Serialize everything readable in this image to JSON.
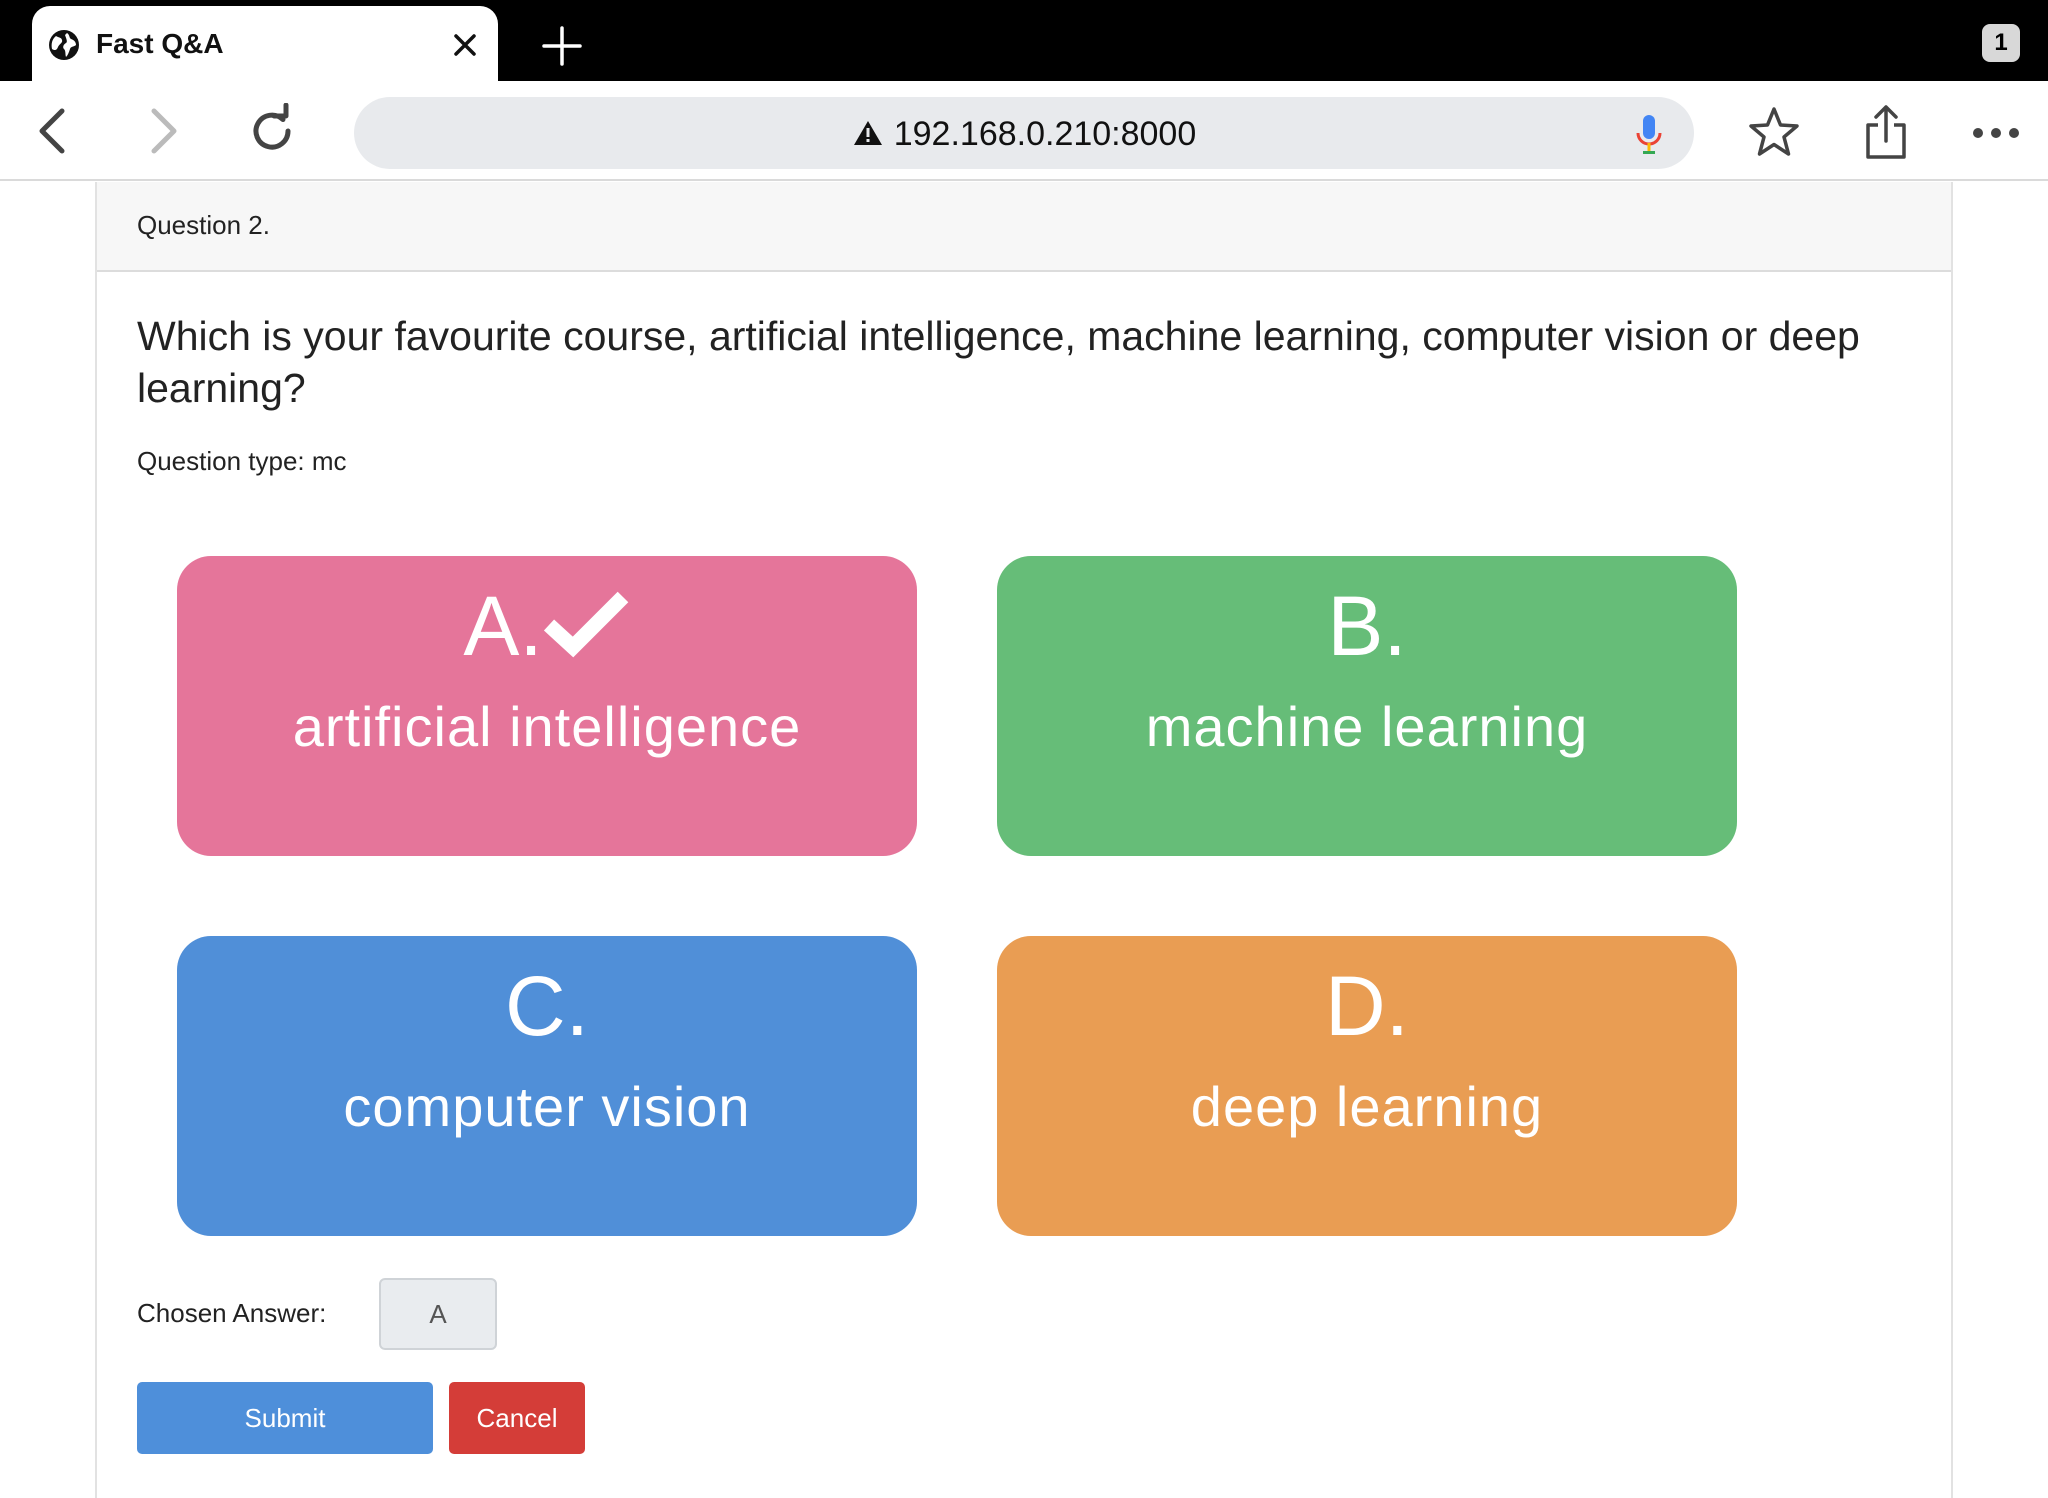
{
  "browser": {
    "tab": {
      "title": "Fast Q&A"
    },
    "tab_count": "1",
    "address": {
      "url": "192.168.0.210:8000",
      "security": "warning-icon"
    }
  },
  "card": {
    "header": "Question 2.",
    "question": "Which is your favourite course, artificial intelligence, machine learning, computer vision or deep learning?",
    "question_type": "Question type: mc"
  },
  "options": [
    {
      "letter": "A.",
      "label": "artificial intelligence",
      "selected": true,
      "color": "#e5759a"
    },
    {
      "letter": "B.",
      "label": "machine learning",
      "selected": false,
      "color": "#66bd78"
    },
    {
      "letter": "C.",
      "label": "computer vision",
      "selected": false,
      "color": "#508fd8"
    },
    {
      "letter": "D.",
      "label": "deep learning",
      "selected": false,
      "color": "#e99d53"
    }
  ],
  "chosen": {
    "label": "Chosen Answer:",
    "value": "A"
  },
  "actions": {
    "submit": "Submit",
    "cancel": "Cancel"
  }
}
